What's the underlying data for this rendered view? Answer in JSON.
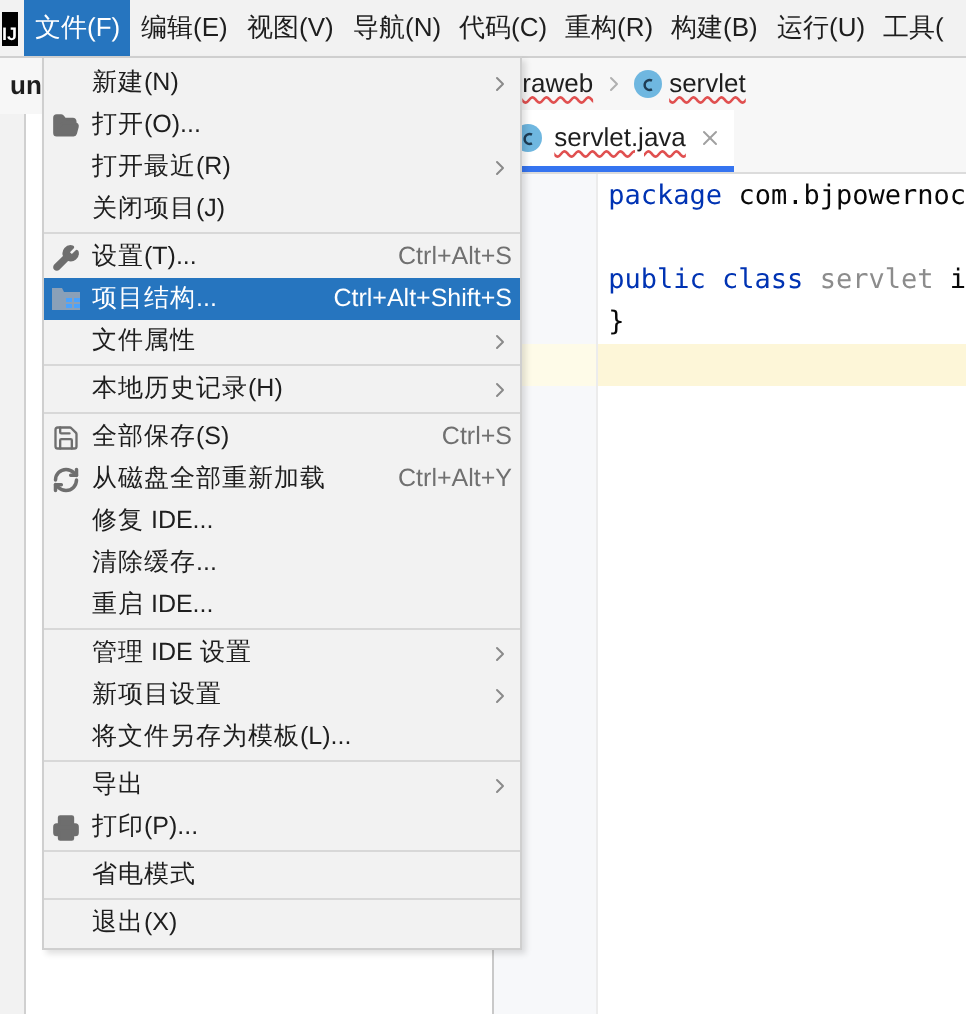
{
  "menubar": {
    "logo": "IJ",
    "items": [
      {
        "label": "文件(F)",
        "selected": true
      },
      {
        "label": "编辑(E)",
        "selected": false
      },
      {
        "label": "视图(V)",
        "selected": false
      },
      {
        "label": "导航(N)",
        "selected": false
      },
      {
        "label": "代码(C)",
        "selected": false
      },
      {
        "label": "重构(R)",
        "selected": false
      },
      {
        "label": "构建(B)",
        "selected": false
      },
      {
        "label": "运行(U)",
        "selected": false
      },
      {
        "label": "工具(",
        "selected": false
      }
    ]
  },
  "project_panel": {
    "title": "un"
  },
  "breadcrumb": [
    {
      "label": "raweb",
      "kind": "folder"
    },
    {
      "label": "servlet",
      "kind": "class"
    }
  ],
  "editor_tabs": [
    {
      "label": "servlet.java",
      "selected": true
    }
  ],
  "code_lines": [
    {
      "tokens": [
        {
          "text": "package",
          "kind": "keyword"
        },
        {
          "text": " com.bjpowernoc",
          "kind": "plain"
        }
      ],
      "current": false
    },
    {
      "current": false
    },
    {
      "tokens": [
        {
          "text": "public class",
          "kind": "keyword"
        },
        {
          "text": " servlet",
          "kind": "unused"
        },
        {
          "text": " i",
          "kind": "plain"
        }
      ],
      "current": false
    },
    {
      "tokens": [
        {
          "text": "}",
          "kind": "plain"
        }
      ],
      "current": false
    },
    {
      "current": true
    }
  ],
  "file_menu": [
    {
      "kind": "item",
      "label": "新建(N)",
      "submenu": true,
      "selected": false
    },
    {
      "kind": "folder",
      "label": "打开(O)...",
      "selected": false
    },
    {
      "kind": "item",
      "label": "打开最近(R)",
      "submenu": true,
      "selected": false
    },
    {
      "kind": "item",
      "label": "关闭项目(J)",
      "selected": false
    },
    {
      "kind": "separator"
    },
    {
      "kind": "wrench",
      "label": "设置(T)...",
      "shortcut": "Ctrl+Alt+S",
      "selected": false
    },
    {
      "kind": "structure",
      "label": "项目结构...",
      "shortcut": "Ctrl+Alt+Shift+S",
      "selected": true
    },
    {
      "kind": "item",
      "label": "文件属性",
      "submenu": true,
      "selected": false
    },
    {
      "kind": "separator"
    },
    {
      "kind": "item",
      "label": "本地历史记录(H)",
      "submenu": true,
      "selected": false
    },
    {
      "kind": "separator"
    },
    {
      "kind": "save",
      "label": "全部保存(S)",
      "shortcut": "Ctrl+S",
      "selected": false
    },
    {
      "kind": "reload",
      "label": "从磁盘全部重新加载",
      "shortcut": "Ctrl+Alt+Y",
      "selected": false
    },
    {
      "kind": "item",
      "label": "修复 IDE...",
      "selected": false
    },
    {
      "kind": "item",
      "label": "清除缓存...",
      "selected": false
    },
    {
      "kind": "item",
      "label": "重启 IDE...",
      "selected": false
    },
    {
      "kind": "separator"
    },
    {
      "kind": "item",
      "label": "管理 IDE 设置",
      "submenu": true,
      "selected": false
    },
    {
      "kind": "item",
      "label": "新项目设置",
      "submenu": true,
      "selected": false
    },
    {
      "kind": "item",
      "label": "将文件另存为模板(L)...",
      "selected": false
    },
    {
      "kind": "separator"
    },
    {
      "kind": "item",
      "label": "导出",
      "submenu": true,
      "selected": false
    },
    {
      "kind": "print",
      "label": "打印(P)...",
      "selected": false
    },
    {
      "kind": "separator"
    },
    {
      "kind": "item",
      "label": "省电模式",
      "selected": false
    },
    {
      "kind": "separator"
    },
    {
      "kind": "item",
      "label": "退出(X)",
      "selected": false
    }
  ]
}
